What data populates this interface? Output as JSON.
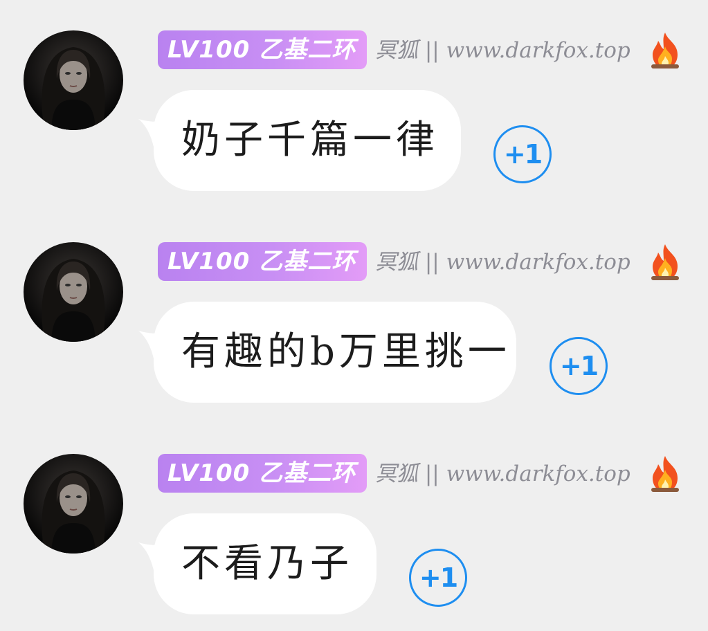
{
  "user": {
    "badge": "LV100 乙基二环",
    "nickname": "冥狐 || www.darkfox.top",
    "badge_colors": [
      "#b982f0",
      "#e39cf7"
    ],
    "fire_icon": "fire-icon"
  },
  "messages": [
    {
      "text": "奶子千篇一律",
      "reaction": "+1"
    },
    {
      "text": "有趣的b万里挑一",
      "reaction": "+1"
    },
    {
      "text": "不看乃子",
      "reaction": "+1"
    }
  ],
  "colors": {
    "background": "#efefef",
    "bubble": "#ffffff",
    "reaction": "#1e8ef0"
  }
}
